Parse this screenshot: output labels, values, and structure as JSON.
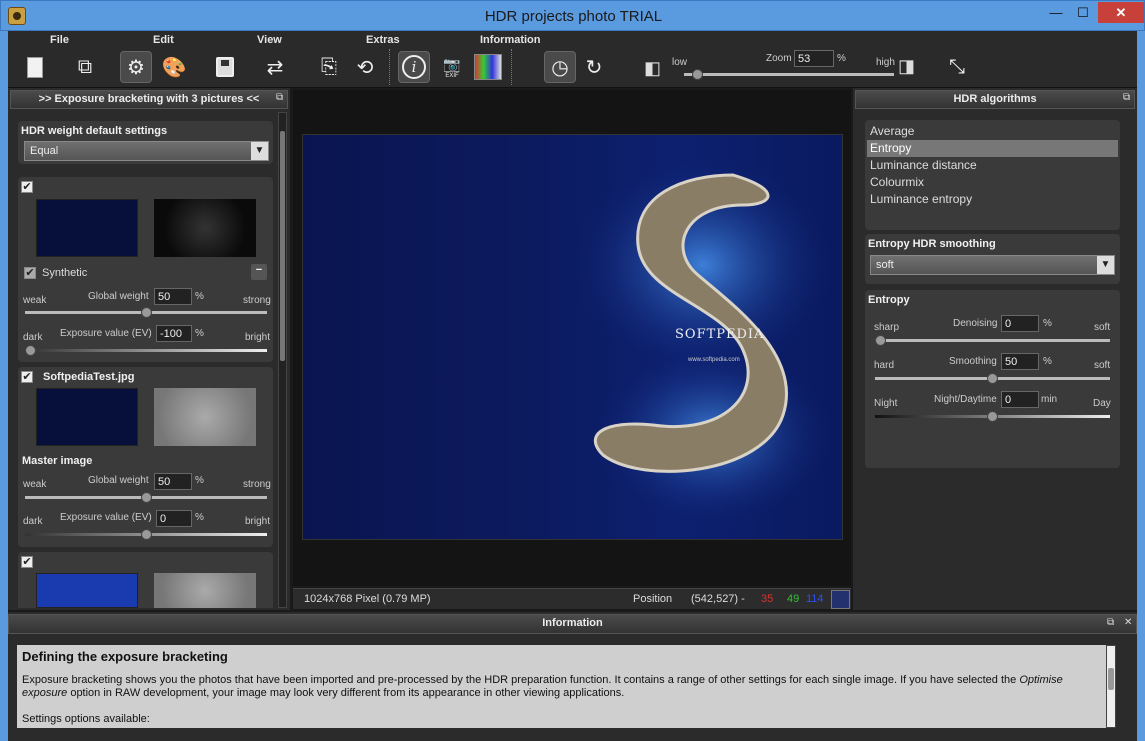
{
  "window": {
    "title": "HDR projects photo  TRIAL",
    "minimize": "—",
    "maximize": "☐",
    "close": "✕"
  },
  "menu": {
    "file": "File",
    "edit": "Edit",
    "view": "View",
    "extras": "Extras",
    "information": "Information"
  },
  "toolbar": {
    "exif_label": "EXIF",
    "zoom_low": "low",
    "zoom_label": "Zoom",
    "zoom_value": "53",
    "zoom_unit": "%",
    "zoom_high": "high",
    "zoom_level": 0.53
  },
  "left_panel": {
    "header": ">> Exposure bracketing with 3 pictures <<",
    "weight_settings_label": "HDR weight default settings",
    "weight_settings_value": "Equal",
    "images": [
      {
        "checked": true,
        "name": "",
        "caption": "Synthetic",
        "caption_checked": true,
        "weight_weak": "weak",
        "weight_label": "Global weight",
        "weight_value": "50",
        "weight_unit": "%",
        "weight_strong": "strong",
        "weight_level": 0.5,
        "ev_dark": "dark",
        "ev_label": "Exposure value (EV)",
        "ev_value": "-100",
        "ev_unit": "%",
        "ev_bright": "bright",
        "ev_level": 0.0
      },
      {
        "checked": true,
        "name": "SoftpediaTest.jpg",
        "caption": "Master image",
        "weight_weak": "weak",
        "weight_label": "Global weight",
        "weight_value": "50",
        "weight_unit": "%",
        "weight_strong": "strong",
        "weight_level": 0.5,
        "ev_dark": "dark",
        "ev_label": "Exposure value (EV)",
        "ev_value": "0",
        "ev_unit": "%",
        "ev_bright": "bright",
        "ev_level": 0.5
      },
      {
        "checked": true,
        "name": ""
      }
    ]
  },
  "image_view": {
    "watermark": "SOFTPEDIA",
    "url": "www.softpedia.com"
  },
  "status": {
    "size": "1024x768 Pixel (0.79 MP)",
    "position_label": "Position",
    "position_value": "(542,527) -",
    "r": "35",
    "g": "49",
    "b": "114",
    "swatch": "#23316f"
  },
  "right_panel": {
    "header": "HDR algorithms",
    "algorithms": [
      "Average",
      "Entropy",
      "Luminance distance",
      "Colourmix",
      "Luminance entropy"
    ],
    "selected_index": 1,
    "smoothing_label": "Entropy HDR smoothing",
    "smoothing_value": "soft",
    "entropy_title": "Entropy",
    "denoising": {
      "left": "sharp",
      "label": "Denoising",
      "value": "0",
      "unit": "%",
      "right": "soft",
      "level": 0.0
    },
    "smoothing": {
      "left": "hard",
      "label": "Smoothing",
      "value": "50",
      "unit": "%",
      "right": "soft",
      "level": 0.5
    },
    "night": {
      "left": "Night",
      "label": "Night/Daytime",
      "value": "0",
      "unit": "min",
      "right": "Day",
      "level": 0.5
    }
  },
  "info_panel": {
    "header": "Information",
    "title": "Defining the exposure bracketing",
    "body_1": "Exposure bracketing shows you the photos that have been imported and pre-processed by the HDR preparation function. It contains a range of other settings for each single image. If you have selected the ",
    "body_em": "Optimise exposure",
    "body_2": " option in RAW development, your image may look very different from its appearance in other viewing applications.",
    "body_3": "Settings options available:"
  },
  "colors": {
    "titlebar": "#5a9be0",
    "close": "#c7413a",
    "panel_bg": "#2b2b2b",
    "red": "#e03030",
    "green": "#30c030",
    "blue": "#3050f0"
  }
}
